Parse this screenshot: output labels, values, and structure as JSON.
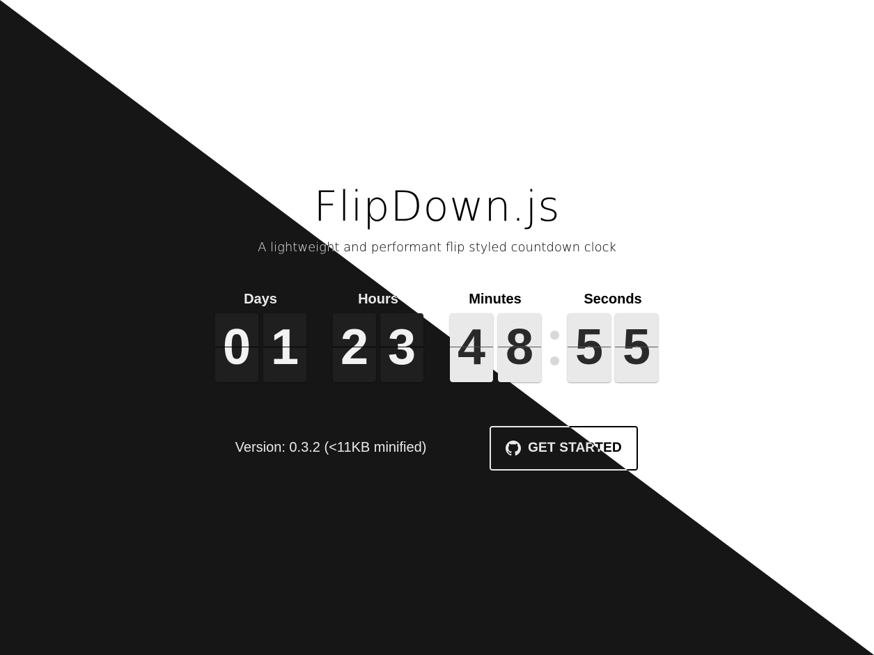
{
  "title": "FlipDown.js",
  "subtitle": "A lightweight and performant flip styled countdown clock",
  "countdown": {
    "labels": {
      "days": "Days",
      "hours": "Hours",
      "minutes": "Minutes",
      "seconds": "Seconds"
    },
    "digits": {
      "days": [
        "0",
        "1"
      ],
      "hours": [
        "2",
        "3"
      ],
      "minutes": [
        "4",
        "8"
      ],
      "seconds": [
        "5",
        "5"
      ]
    }
  },
  "version_text": "Version: 0.3.2 (<11KB minified)",
  "cta": {
    "label": "GET STARTED",
    "icon": "github-icon"
  },
  "colors": {
    "dark": "#161616",
    "light": "#ffffff"
  }
}
